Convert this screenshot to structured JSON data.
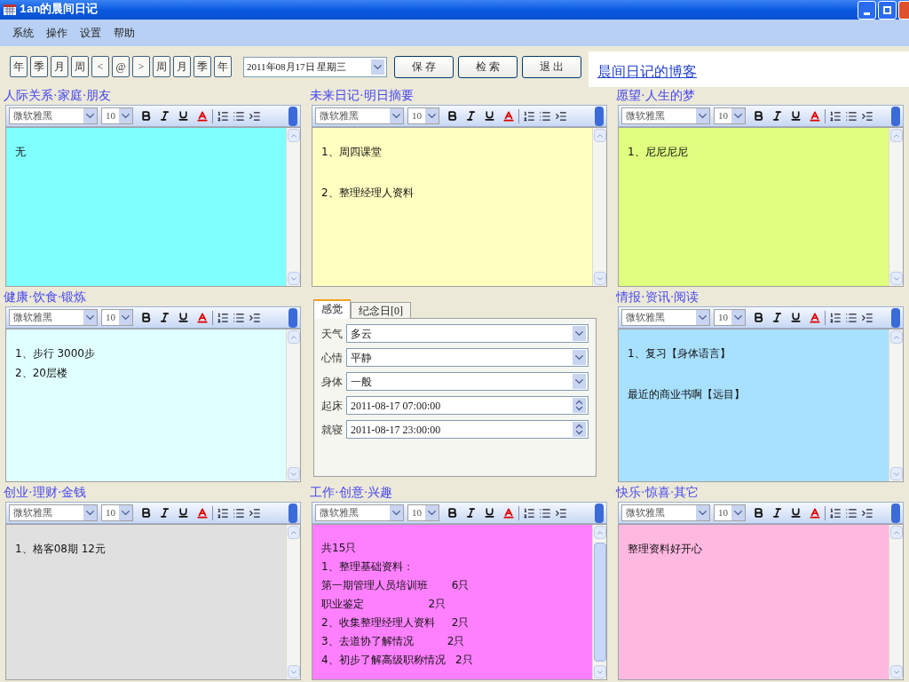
{
  "window": {
    "title": "1an的晨间日记"
  },
  "menu": [
    "系统",
    "操作",
    "设置",
    "帮助"
  ],
  "nav_buttons": [
    "年",
    "季",
    "月",
    "周",
    "<",
    "@",
    ">",
    "周",
    "月",
    "季",
    "年"
  ],
  "date_select": {
    "value": "2011年08月17日 星期三"
  },
  "buttons": [
    "保 存",
    "检 索",
    "退 出"
  ],
  "blog_link": "晨间日记的博客",
  "panels": [
    {
      "kind": "editor",
      "title": "人际关系·家庭·朋友",
      "color": "#80ffff",
      "font": "微软雅黑",
      "size": "10",
      "paragraphs": [
        [
          "无"
        ]
      ]
    },
    {
      "kind": "editor",
      "title": "未来日记·明日摘要",
      "color": "#ffffc0",
      "font": "微软雅黑",
      "size": "10",
      "paragraphs": [
        [
          "1、周四课堂"
        ],
        [
          "2、整理经理人资料"
        ]
      ]
    },
    {
      "kind": "editor",
      "title": "愿望·人生的梦",
      "color": "#e0ff80",
      "font": "微软雅黑",
      "size": "10",
      "paragraphs": [
        [
          "1、尼尼尼尼"
        ]
      ]
    },
    {
      "kind": "editor",
      "title": "健康·饮食·锻炼",
      "color": "#e0ffff",
      "font": "微软雅黑",
      "size": "10",
      "paragraphs": [
        [
          "1、步行 3000步",
          "2、20层楼"
        ]
      ]
    },
    {
      "kind": "form",
      "tabs": [
        {
          "label": "感觉",
          "selected": true
        },
        {
          "label": "纪念日[0]",
          "selected": false
        }
      ],
      "fields": [
        {
          "label": "天气",
          "value": "多云",
          "kind": "dropdown"
        },
        {
          "label": "心情",
          "value": "平静",
          "kind": "dropdown"
        },
        {
          "label": "身体",
          "value": "一般",
          "kind": "dropdown"
        },
        {
          "label": "起床",
          "value": "2011-08-17 07:00:00",
          "kind": "spinner"
        },
        {
          "label": "就寝",
          "value": "2011-08-17 23:00:00",
          "kind": "spinner"
        }
      ]
    },
    {
      "kind": "editor",
      "title": "情报·资讯·阅读",
      "color": "#a8e0ff",
      "font": "微软雅黑",
      "size": "10",
      "paragraphs": [
        [
          "1、复习【身体语言】"
        ],
        [
          "最近的商业书啊【远目】"
        ]
      ]
    },
    {
      "kind": "editor",
      "title": "创业·理财·金钱",
      "color": "#e0e0e0",
      "font": "微软雅黑",
      "size": "10",
      "paragraphs": [
        [
          "1、格客08期 12元"
        ]
      ]
    },
    {
      "kind": "editor",
      "title": "工作·创意·兴趣",
      "color": "#ff80ff",
      "font": "微软雅黑",
      "size": "10",
      "paragraphs": [
        [
          "共15只",
          "1、整理基础资料：",
          "第一期管理人员培训班       6只",
          "职业鉴定                   2只",
          "2、收集整理经理人资料     2只",
          "3、去道协了解情况          2只",
          "4、初步了解高级职称情况   2只"
        ]
      ]
    },
    {
      "kind": "editor",
      "title": "快乐·惊喜·其它",
      "color": "#ffb8e0",
      "font": "微软雅黑",
      "size": "10",
      "paragraphs": [
        [
          "整理资料好开心"
        ]
      ]
    }
  ]
}
